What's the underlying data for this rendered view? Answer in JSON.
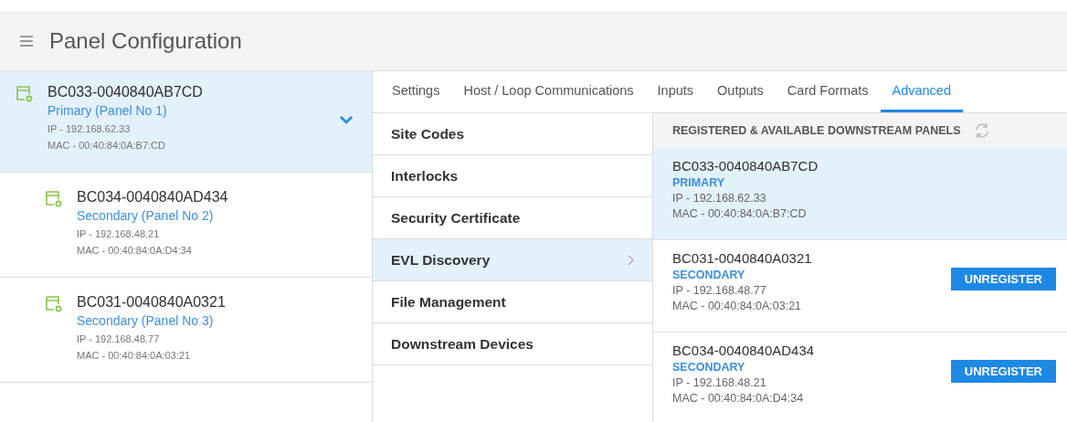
{
  "header": {
    "title": "Panel Configuration"
  },
  "panels": [
    {
      "name": "BC033-0040840AB7CD",
      "role": "Primary (Panel No 1)",
      "ip": "IP - 192.168.62.33",
      "mac": "MAC - 00:40:84:0A:B7:CD",
      "selected": true,
      "expanded": true,
      "children": [
        {
          "name": "BC034-0040840AD434",
          "role": "Secondary (Panel No 2)",
          "ip": "IP - 192.168.48.21",
          "mac": "MAC - 00:40:84:0A:D4:34",
          "selected": false
        },
        {
          "name": "BC031-0040840A0321",
          "role": "Secondary (Panel No 3)",
          "ip": "IP - 192.168.48.77",
          "mac": "MAC - 00:40:84:0A:03:21",
          "selected": false
        }
      ]
    }
  ],
  "tabs": [
    {
      "label": "Settings",
      "selected": false
    },
    {
      "label": "Host / Loop Communications",
      "selected": false
    },
    {
      "label": "Inputs",
      "selected": false
    },
    {
      "label": "Outputs",
      "selected": false
    },
    {
      "label": "Card Formats",
      "selected": false
    },
    {
      "label": "Advanced",
      "selected": true
    }
  ],
  "menu": [
    {
      "label": "Site Codes",
      "selected": false
    },
    {
      "label": "Interlocks",
      "selected": false
    },
    {
      "label": "Security Certificate",
      "selected": false
    },
    {
      "label": "EVL Discovery",
      "selected": true
    },
    {
      "label": "File Management",
      "selected": false
    },
    {
      "label": "Downstream Devices",
      "selected": false
    }
  ],
  "downstream": {
    "title": "REGISTERED & AVAILABLE DOWNSTREAM PANELS",
    "panels": [
      {
        "name": "BC033-0040840AB7CD",
        "role": "PRIMARY",
        "ip": "IP - 192.168.62.33",
        "mac": "MAC - 00:40:84:0A:B7:CD",
        "selected": true
      },
      {
        "name": "BC031-0040840A0321",
        "role": "SECONDARY",
        "ip": "IP - 192.168.48.77",
        "mac": "MAC - 00:40:84:0A:03:21",
        "selected": false,
        "button": "UNREGISTER"
      },
      {
        "name": "BC034-0040840AD434",
        "role": "SECONDARY",
        "ip": "IP - 192.168.48.21",
        "mac": "MAC - 00:40:84:0A:D4:34",
        "selected": false,
        "button": "UNREGISTER"
      }
    ]
  }
}
